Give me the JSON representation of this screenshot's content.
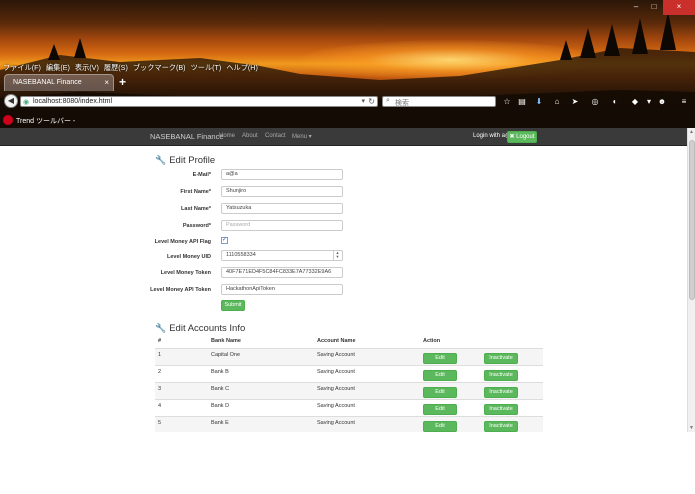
{
  "browser": {
    "menu": [
      "ファイル(F)",
      "編集(E)",
      "表示(V)",
      "履歴(S)",
      "ブックマーク(B)",
      "ツール(T)",
      "ヘルプ(H)"
    ],
    "tab_title": "NASEBANAL Finance",
    "tab_close": "×",
    "new_tab": "+",
    "url": "localhost:8080/index.html",
    "search_placeholder": "検索",
    "trend_toolbar": "Trend ツールバー -",
    "window_buttons": {
      "minimize": "–",
      "maximize": "□",
      "close": "×"
    }
  },
  "app": {
    "brand": "NASEBANAL Finance",
    "nav": [
      "Home",
      "About",
      "Contact",
      "Menu ▾"
    ],
    "login_text": "Login with a@a",
    "logout_label": "✖ Logout"
  },
  "profile": {
    "title": "Edit Profile",
    "fields": [
      {
        "label": "E-Mail*",
        "value": "a@a"
      },
      {
        "label": "First Name*",
        "value": "Shunjiro"
      },
      {
        "label": "Last Name*",
        "value": "Yatsuzuka"
      },
      {
        "label": "Password*",
        "placeholder": "Password"
      },
      {
        "label": "Level Money API Flag",
        "checked": true
      },
      {
        "label": "Level Money UID",
        "value": "1110558334"
      },
      {
        "label": "Level Money Token",
        "value": "40F7E71ED4F5C84FC833E7A77332E9A6"
      },
      {
        "label": "Level Money API Token",
        "value": "HackathonApiToken"
      }
    ],
    "submit_label": "Submit"
  },
  "accounts": {
    "title": "Edit Accounts Info",
    "columns": [
      "#",
      "Bank Name",
      "Account Name",
      "Action"
    ],
    "rows": [
      {
        "num": "1",
        "bank": "Capital One",
        "account": "Saving Account"
      },
      {
        "num": "2",
        "bank": "Bank B",
        "account": "Saving Account"
      },
      {
        "num": "3",
        "bank": "Bank C",
        "account": "Saving Account"
      },
      {
        "num": "4",
        "bank": "Bank D",
        "account": "Saving Account"
      },
      {
        "num": "5",
        "bank": "Bank E",
        "account": "Saving Account"
      }
    ],
    "edit_label": "Edit",
    "inactivate_label": "Inactivate"
  },
  "colors": {
    "accent_green": "#5cb85c",
    "navbar": "#3a3a3a",
    "close_red": "#c9302c"
  }
}
